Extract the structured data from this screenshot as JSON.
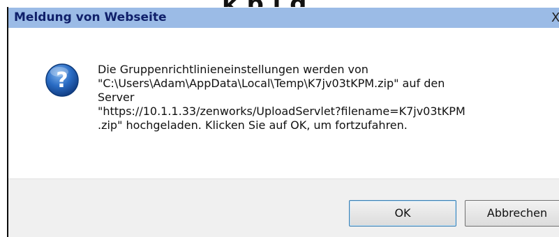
{
  "background": {
    "heading_fragment": "k p   j g"
  },
  "dialog": {
    "title": "Meldung von Webseite",
    "close_glyph": "X",
    "icon": "question-icon",
    "message_lines": [
      "Die Gruppenrichtlinieneinstellungen werden von",
      "\"C:\\Users\\Adam\\AppData\\Local\\Temp\\K7jv03tKPM.zip\" auf den",
      "Server",
      "\"https://10.1.1.33/zenworks/UploadServlet?filename=K7jv03tKPM",
      ".zip\" hochgeladen. Klicken Sie auf OK, um fortzufahren."
    ],
    "buttons": {
      "ok": "OK",
      "cancel": "Abbrechen"
    }
  },
  "colors": {
    "titlebar": "#9bbbe6",
    "title_text": "#10206a",
    "icon_blue": "#1f5fb4",
    "footer": "#f0f0f0"
  }
}
